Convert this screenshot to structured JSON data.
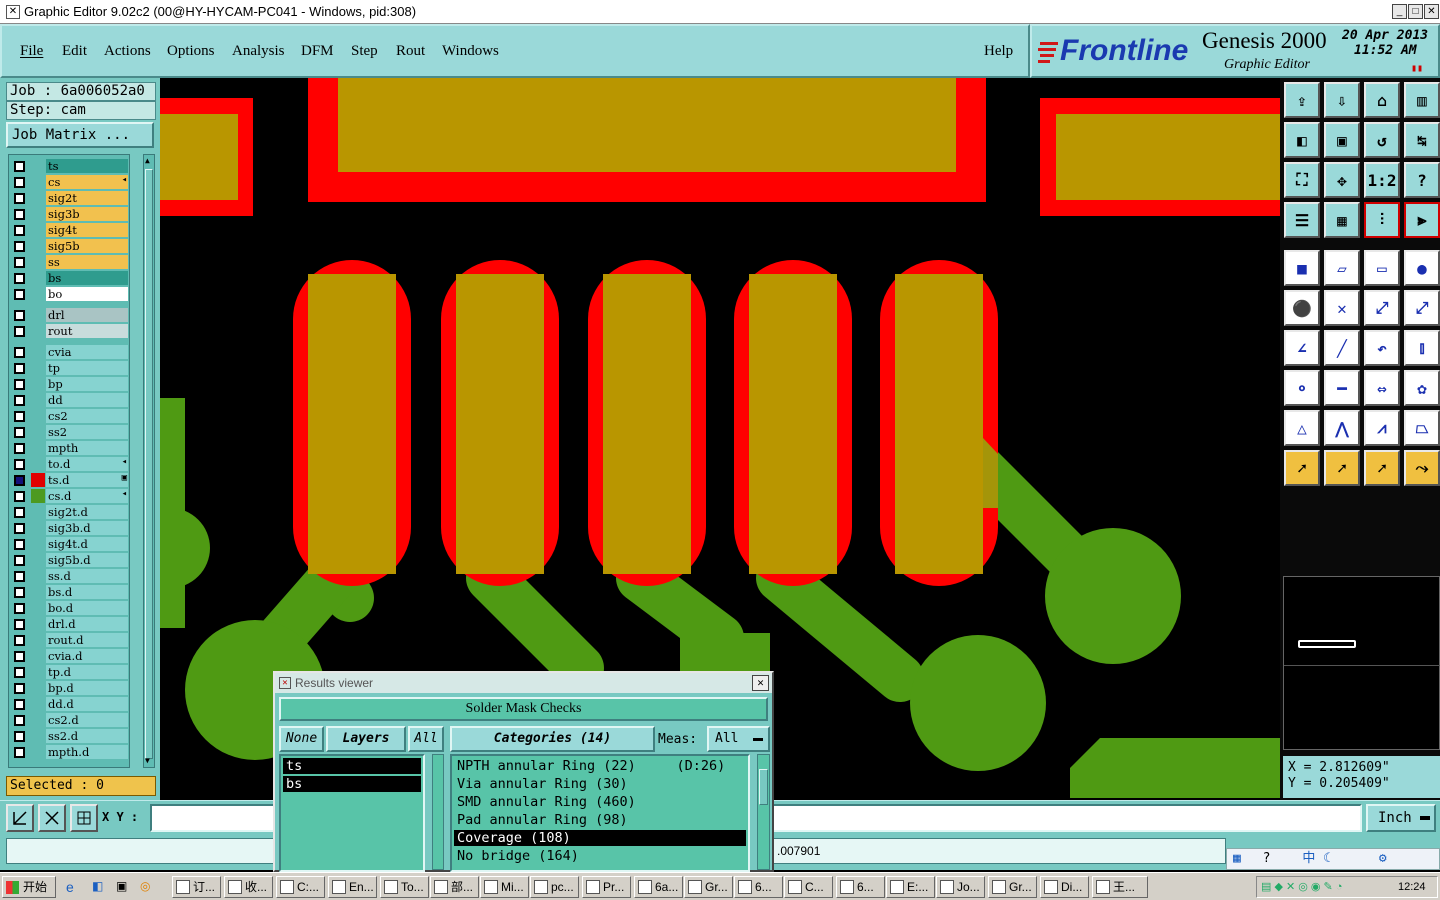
{
  "title_bar": {
    "text": "Graphic Editor 9.02c2 (00@HY-HYCAM-PC041 - Windows, pid:308)"
  },
  "menu": {
    "items": [
      "File",
      "Edit",
      "Actions",
      "Options",
      "Analysis",
      "DFM",
      "Step",
      "Rout",
      "Windows"
    ],
    "help": "Help"
  },
  "logo": {
    "brand": "Frontline",
    "product": "Genesis 2000",
    "subtitle": "Graphic Editor",
    "date": "20 Apr 2013",
    "time": "11:52 AM"
  },
  "left": {
    "job": "Job : 6a006052a0",
    "step": "Step: cam",
    "job_matrix": "Job Matrix ...",
    "selected": "Selected : 0",
    "groups": [
      [
        {
          "name": "ts",
          "bg": "#2f9c8e"
        },
        {
          "name": "cs",
          "bg": "#f2c14e",
          "arrow": "◂"
        },
        {
          "name": "sig2t",
          "bg": "#f2c14e"
        },
        {
          "name": "sig3b",
          "bg": "#f2c14e"
        },
        {
          "name": "sig4t",
          "bg": "#f2c14e"
        },
        {
          "name": "sig5b",
          "bg": "#f2c14e"
        },
        {
          "name": "ss",
          "bg": "#f2c14e"
        },
        {
          "name": "bs",
          "bg": "#2f9c8e"
        },
        {
          "name": "bo",
          "bg": "#ffffff"
        }
      ],
      [
        {
          "name": "drl",
          "bg": "#a9c4c4"
        },
        {
          "name": "rout",
          "bg": "#c8dcdc"
        }
      ],
      [
        {
          "name": "cvia",
          "bg": "#86d3d0"
        },
        {
          "name": "tp",
          "bg": "#86d3d0"
        },
        {
          "name": "bp",
          "bg": "#86d3d0"
        },
        {
          "name": "dd",
          "bg": "#86d3d0"
        },
        {
          "name": "cs2",
          "bg": "#86d3d0"
        },
        {
          "name": "ss2",
          "bg": "#86d3d0"
        },
        {
          "name": "mpth",
          "bg": "#86d3d0"
        },
        {
          "name": "to.d",
          "bg": "#86d3d0",
          "arrow": "◂"
        },
        {
          "name": "ts.d",
          "bg": "#86d3d0",
          "arrow": "▣",
          "swatch": "#e00000",
          "checked": "#14107a"
        },
        {
          "name": "cs.d",
          "bg": "#86d3d0",
          "arrow": "◂",
          "swatch": "#4d9a20"
        },
        {
          "name": "sig2t.d",
          "bg": "#86d3d0"
        },
        {
          "name": "sig3b.d",
          "bg": "#86d3d0"
        },
        {
          "name": "sig4t.d",
          "bg": "#86d3d0"
        },
        {
          "name": "sig5b.d",
          "bg": "#86d3d0"
        },
        {
          "name": "ss.d",
          "bg": "#86d3d0"
        },
        {
          "name": "bs.d",
          "bg": "#86d3d0"
        },
        {
          "name": "bo.d",
          "bg": "#86d3d0"
        },
        {
          "name": "drl.d",
          "bg": "#86d3d0"
        },
        {
          "name": "rout.d",
          "bg": "#86d3d0"
        },
        {
          "name": "cvia.d",
          "bg": "#86d3d0"
        },
        {
          "name": "tp.d",
          "bg": "#86d3d0"
        },
        {
          "name": "bp.d",
          "bg": "#86d3d0"
        },
        {
          "name": "dd.d",
          "bg": "#86d3d0"
        },
        {
          "name": "cs2.d",
          "bg": "#86d3d0"
        },
        {
          "name": "ss2.d",
          "bg": "#86d3d0"
        },
        {
          "name": "mpth.d",
          "bg": "#86d3d0"
        }
      ]
    ]
  },
  "coords": {
    "x": "X = 2.812609\"",
    "y": "Y = 0.205409\""
  },
  "bottom": {
    "xy_label": "X Y :",
    "unit": "Inch",
    "status_value": ".007901"
  },
  "results": {
    "window_title": "Results viewer",
    "header": "Solder Mask Checks",
    "none_btn": "None",
    "layers_btn": "Layers",
    "all_btn": "All",
    "categories_btn": "Categories (14)",
    "meas_label": "Meas:",
    "meas_value": "All",
    "layers": [
      "ts",
      "bs"
    ],
    "categories": [
      "NPTH annular Ring (22)     (D:26)",
      "Via annular Ring (30)",
      "SMD annular Ring (460)",
      "Pad annular Ring (98)",
      "Coverage (108)",
      "No bridge (164)"
    ],
    "selected_category_index": 4
  },
  "taskbar": {
    "start": "开始",
    "tasks": [
      "订...",
      "收...",
      "C:...",
      "En...",
      "To...",
      "部...",
      "Mi...",
      "pc...",
      "Pr...",
      "6a...",
      "Gr...",
      "6...",
      "C...",
      "6...",
      "E:...",
      "Jo...",
      "Gr...",
      "Di...",
      "王..."
    ],
    "clock": "12:24"
  },
  "colors": {
    "copper": "#b99600",
    "mask": "#ff0000",
    "trace": "#4f9a13",
    "panel": "#78c9c2"
  }
}
